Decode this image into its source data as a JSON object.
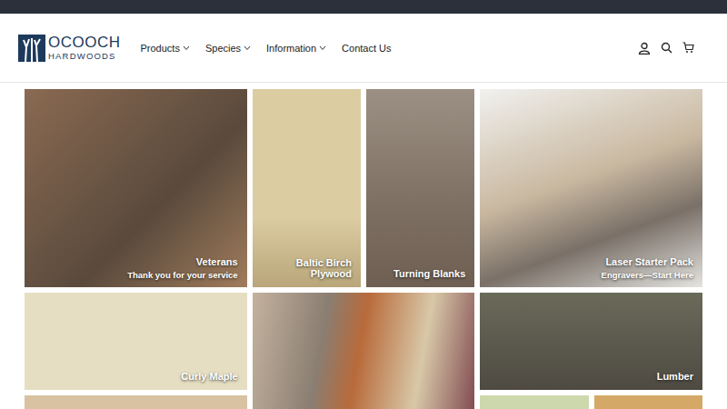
{
  "logo": {
    "name": "OCOOCH",
    "tagline": "HARDWOODS"
  },
  "nav": [
    {
      "label": "Products",
      "has_menu": true
    },
    {
      "label": "Species",
      "has_menu": true
    },
    {
      "label": "Information",
      "has_menu": true
    },
    {
      "label": "Contact Us",
      "has_menu": false
    }
  ],
  "tiles": [
    {
      "title": "Veterans",
      "subtitle": "Thank you for your service"
    },
    {
      "title": "Baltic Birch Plywood",
      "subtitle": ""
    },
    {
      "title": "Turning Blanks",
      "subtitle": ""
    },
    {
      "title": "Laser Starter Pack",
      "subtitle": "Engravers—Start Here"
    },
    {
      "title": "Curly Maple",
      "subtitle": ""
    },
    {
      "title": "",
      "subtitle": ""
    },
    {
      "title": "Lumber",
      "subtitle": ""
    },
    {
      "title": "",
      "subtitle": ""
    },
    {
      "title": "",
      "subtitle": ""
    },
    {
      "title": "",
      "subtitle": ""
    }
  ]
}
